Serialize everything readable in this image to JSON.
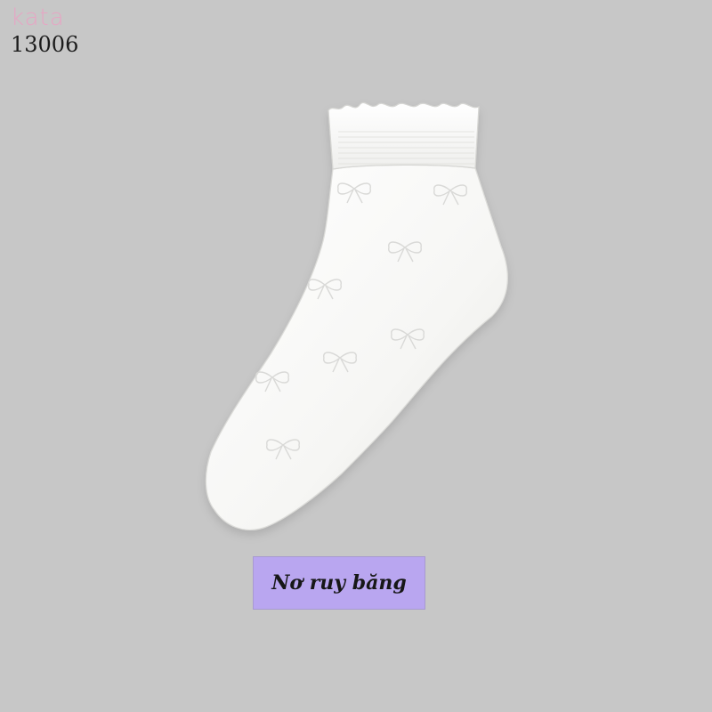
{
  "branding": {
    "logo_text": "kata",
    "product_code": "13006"
  },
  "product": {
    "image_subject": "sock",
    "pattern_icon": "bow-icon",
    "colors": {
      "background": "#c7c7c7",
      "sock": "#f7f7f5",
      "label_background": "#b9a6f0"
    }
  },
  "label": {
    "text": "Nơ ruy băng"
  }
}
